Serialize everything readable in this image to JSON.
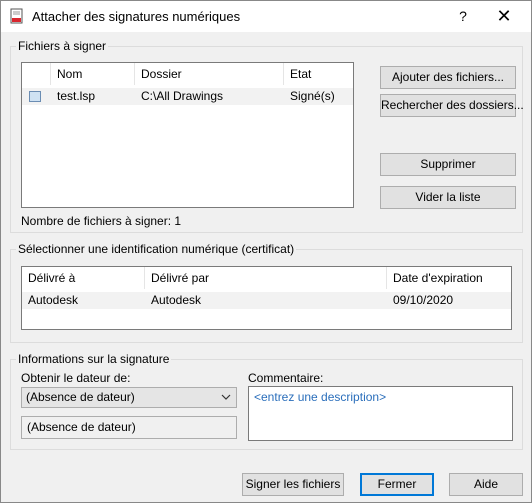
{
  "window": {
    "title": "Attacher des signatures numériques",
    "help_label": "?",
    "close_label": "✕"
  },
  "files_group": {
    "legend": "Fichiers à signer",
    "columns": [
      "Nom",
      "Dossier",
      "Etat"
    ],
    "rows": [
      {
        "name": "test.lsp",
        "folder": "C:\\All Drawings",
        "state": "Signé(s)"
      }
    ],
    "count_text": "Nombre de fichiers à signer: 1",
    "buttons": {
      "add_files": "Ajouter des fichiers...",
      "search_folders": "Rechercher des dossiers...",
      "delete": "Supprimer",
      "clear_list": "Vider la liste"
    }
  },
  "cert_group": {
    "legend": "Sélectionner une identification numérique (certificat)",
    "columns": [
      "Délivré à",
      "Délivré par",
      "Date d'expiration"
    ],
    "rows": [
      {
        "issued_to": "Autodesk",
        "issued_by": "Autodesk",
        "expiry": "09/10/2020"
      }
    ]
  },
  "sig_group": {
    "legend": "Informations sur la signature",
    "timestamp_label": "Obtenir le dateur de:",
    "timestamp_selected": "(Absence de dateur)",
    "timestamp_readonly": "(Absence de dateur)",
    "comment_label": "Commentaire:",
    "comment_placeholder": "<entrez une description>"
  },
  "footer": {
    "sign": "Signer les fichiers",
    "close": "Fermer",
    "help": "Aide"
  }
}
